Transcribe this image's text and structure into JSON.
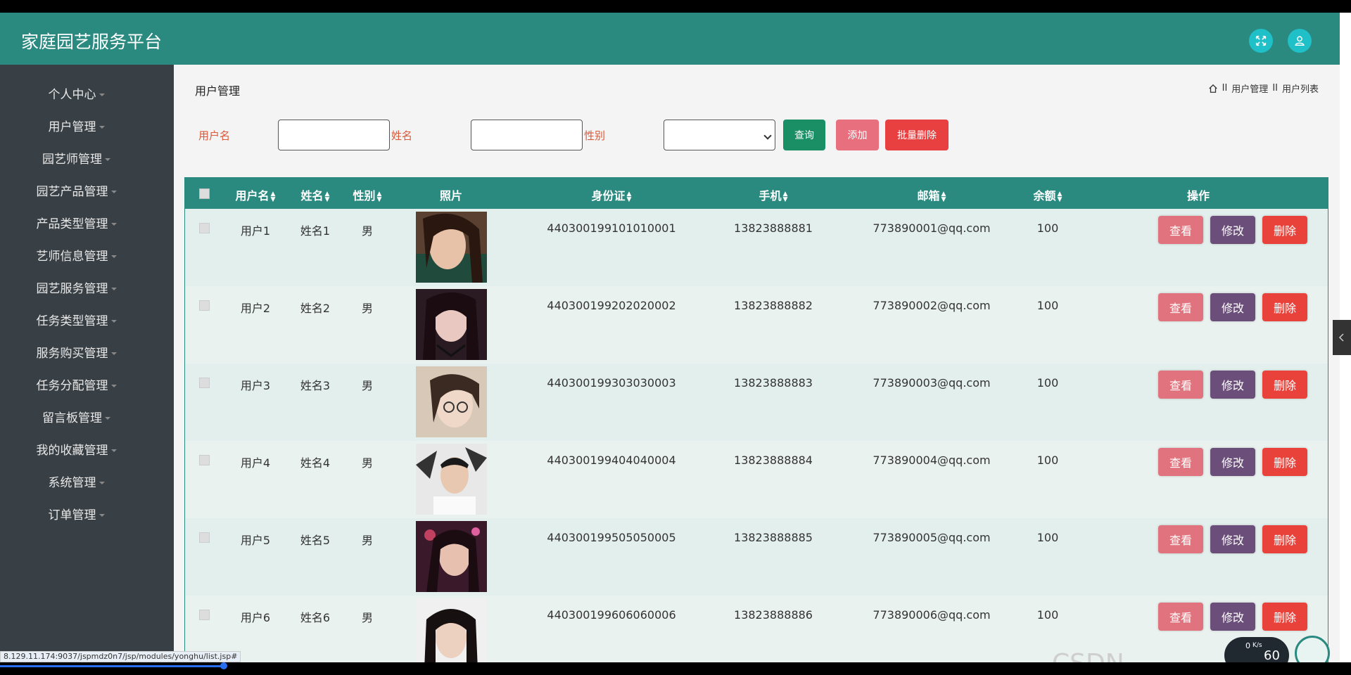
{
  "app": {
    "title": "家庭园艺服务平台"
  },
  "sidebar": {
    "items": [
      {
        "label": "个人中心"
      },
      {
        "label": "用户管理"
      },
      {
        "label": "园艺师管理"
      },
      {
        "label": "园艺产品管理"
      },
      {
        "label": "产品类型管理"
      },
      {
        "label": "艺师信息管理"
      },
      {
        "label": "园艺服务管理"
      },
      {
        "label": "任务类型管理"
      },
      {
        "label": "服务购买管理"
      },
      {
        "label": "任务分配管理"
      },
      {
        "label": "留言板管理"
      },
      {
        "label": "我的收藏管理"
      },
      {
        "label": "系统管理"
      },
      {
        "label": "订单管理"
      }
    ]
  },
  "page": {
    "title": "用户管理",
    "breadcrumb": [
      "II",
      "用户管理",
      "II",
      "用户列表"
    ]
  },
  "filters": {
    "username_label": "用户名",
    "name_label": "姓名",
    "gender_label": "性别",
    "query_button": "查询",
    "add_button": "添加",
    "batch_delete_button": "批量删除"
  },
  "table": {
    "headers": {
      "username": "用户名",
      "name": "姓名",
      "gender": "性别",
      "photo": "照片",
      "id_card": "身份证",
      "phone": "手机",
      "email": "邮箱",
      "balance": "余额",
      "actions": "操作"
    },
    "actions": {
      "view": "查看",
      "edit": "修改",
      "delete": "删除"
    },
    "rows": [
      {
        "username": "用户1",
        "name": "姓名1",
        "gender": "男",
        "id_card": "440300199101010001",
        "phone": "13823888881",
        "email": "773890001@qq.com",
        "balance": "100"
      },
      {
        "username": "用户2",
        "name": "姓名2",
        "gender": "男",
        "id_card": "440300199202020002",
        "phone": "13823888882",
        "email": "773890002@qq.com",
        "balance": "100"
      },
      {
        "username": "用户3",
        "name": "姓名3",
        "gender": "男",
        "id_card": "440300199303030003",
        "phone": "13823888883",
        "email": "773890003@qq.com",
        "balance": "100"
      },
      {
        "username": "用户4",
        "name": "姓名4",
        "gender": "男",
        "id_card": "440300199404040004",
        "phone": "13823888884",
        "email": "773890004@qq.com",
        "balance": "100"
      },
      {
        "username": "用户5",
        "name": "姓名5",
        "gender": "男",
        "id_card": "440300199505050005",
        "phone": "13823888885",
        "email": "773890005@qq.com",
        "balance": "100"
      },
      {
        "username": "用户6",
        "name": "姓名6",
        "gender": "男",
        "id_card": "440300199606060006",
        "phone": "13823888886",
        "email": "773890006@qq.com",
        "balance": "100"
      }
    ]
  },
  "status_url": "8.129.11.174:9037/jspmdz0n7/jsp/modules/yonghu/list.jsp#",
  "watermark": "CSDN @nodejava666666",
  "speed_widget": {
    "value": "0",
    "unit": "K/s",
    "percent": "60"
  },
  "colors": {
    "header": "#2a8a80",
    "sidebar": "#394045",
    "query": "#1a8f66",
    "add": "#e86f7e",
    "batch_delete": "#e84040",
    "view": "#e0737e",
    "edit": "#6b4f7a",
    "delete": "#e8423a"
  },
  "icons": {
    "fullscreen": "fullscreen-icon",
    "user": "user-icon",
    "home": "home-icon"
  }
}
